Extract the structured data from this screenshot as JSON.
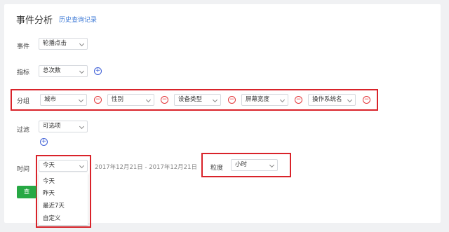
{
  "page": {
    "title": "事件分析",
    "history_link": "历史查询记录"
  },
  "event": {
    "label": "事件",
    "value": "轮播点击"
  },
  "metric": {
    "label": "指标",
    "value": "总次数"
  },
  "group": {
    "label": "分组",
    "items": [
      "城市",
      "性别",
      "设备类型",
      "屏幕宽度",
      "操作系统名"
    ]
  },
  "filter": {
    "label": "过滤",
    "value": "可选项"
  },
  "time": {
    "label": "时间",
    "value": "今天",
    "date_range": "2017年12月21日 - 2017年12月21日",
    "options": [
      "今天",
      "昨天",
      "最近7天",
      "自定义"
    ]
  },
  "granularity": {
    "label": "粒度",
    "value": "小时"
  },
  "query_button": {
    "label": "查"
  },
  "colors": {
    "highlight_box": "#d9232a",
    "primary_button": "#27a844",
    "link": "#3e7ad6",
    "add_icon": "#3e5fd6",
    "remove_icon": "#e4393c"
  },
  "icons": {
    "add": "plus-circle-icon",
    "remove": "minus-circle-icon",
    "dropdown": "chevron-down-icon"
  }
}
